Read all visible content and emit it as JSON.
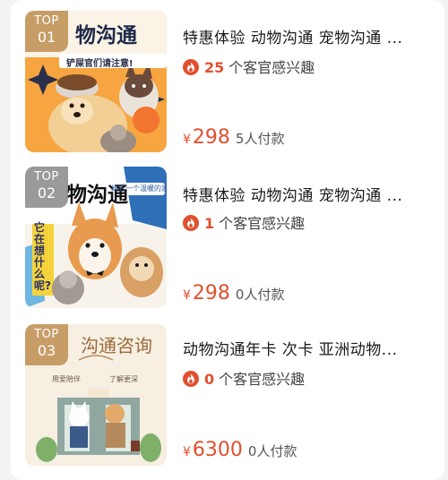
{
  "items": [
    {
      "rank_label": "TOP",
      "rank_num": "01",
      "thumb_text": "物沟通",
      "thumb_sub": "铲屎官们请注意!",
      "title": "特惠体验 动物沟通 宠物沟通 ...",
      "interest_count": "25",
      "interest_text": "个客官感兴趣",
      "currency": "¥",
      "price": "298",
      "paid": "5人付款"
    },
    {
      "rank_label": "TOP",
      "rank_num": "02",
      "thumb_text": "物沟通",
      "thumb_sub": "给它一个温暖的家",
      "thumb_side": "它在想什么呢?",
      "title": "特惠体验 动物沟通 宠物沟通 ...",
      "interest_count": "1",
      "interest_text": "个客官感兴趣",
      "currency": "¥",
      "price": "298",
      "paid": "0人付款"
    },
    {
      "rank_label": "TOP",
      "rank_num": "03",
      "thumb_text": "沟通咨询",
      "thumb_sub1": "用爱陪伴",
      "thumb_sub2": "了解更深",
      "title": "动物沟通年卡 次卡 亚洲动物...",
      "interest_count": "0",
      "interest_text": "个客官感兴趣",
      "currency": "¥",
      "price": "6300",
      "paid": "0人付款"
    }
  ],
  "colors": {
    "accent": "#e0502f",
    "rank_gold": "#c2965c",
    "rank_gray": "#8c8c8c"
  },
  "icons": {
    "interest": "fire-icon"
  }
}
